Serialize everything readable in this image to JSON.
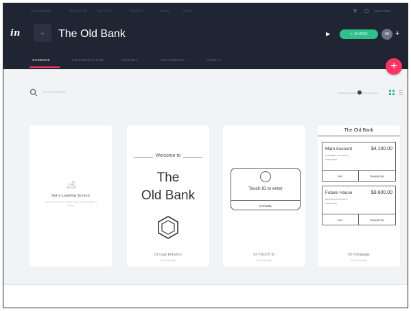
{
  "nav": {
    "items": [
      "DASHBOARD",
      "PROJECTS",
      "ACTIVITY",
      "PEOPLE",
      "LEARN",
      "HELP"
    ],
    "user_name": "Samuel Hess"
  },
  "header": {
    "logo": "in",
    "project_thumb": "+",
    "project_title": "The Old Bank",
    "share_label": "SHARE",
    "avatar_initials": "SH",
    "add_symbol": "+"
  },
  "tabs": [
    "SCREENS",
    "CONVERSATIONS",
    "HISTORY",
    "DOCUMENTS",
    "ASSETS",
    "..."
  ],
  "fab_symbol": "+",
  "toolbar": {
    "search_placeholder": "Search screens",
    "icons": [
      "search-icon",
      "grid-view-icon",
      "list-view-icon"
    ]
  },
  "colors": {
    "topbar": "#1f2533",
    "accent_pink": "#ff3366",
    "share_green": "#2fbf8a"
  },
  "cards": {
    "loading": {
      "title": "Set a Loading Screen",
      "description": "This screen will be shown while your prototype is loading."
    },
    "logo": {
      "welcome": "Welcome to",
      "line1": "The",
      "line2": "Old Bank",
      "label": "01 Logo Entrance",
      "time": "15 hours ago"
    },
    "touch": {
      "prompt": "Touch ID to enter",
      "cancel": "CANCEL",
      "label": "02 TOUCH ID",
      "time": "15 hours ago"
    },
    "home": {
      "header": "The Old Bank",
      "accounts": [
        {
          "name": "Main Account",
          "amount": "$4,100.00",
          "sub1": "CURRENT ACCOUNT",
          "sub2": "0000-0000",
          "pay": "PAY",
          "transfer": "TRANSFER"
        },
        {
          "name": "Future House",
          "amount": "$9,600.00",
          "sub1": "SAVINGS ACCOUNT",
          "sub2": "0000-0000",
          "pay": "PAY",
          "transfer": "TRANSFER"
        }
      ],
      "label": "03 Homepage",
      "time": "15 hours ago"
    }
  }
}
